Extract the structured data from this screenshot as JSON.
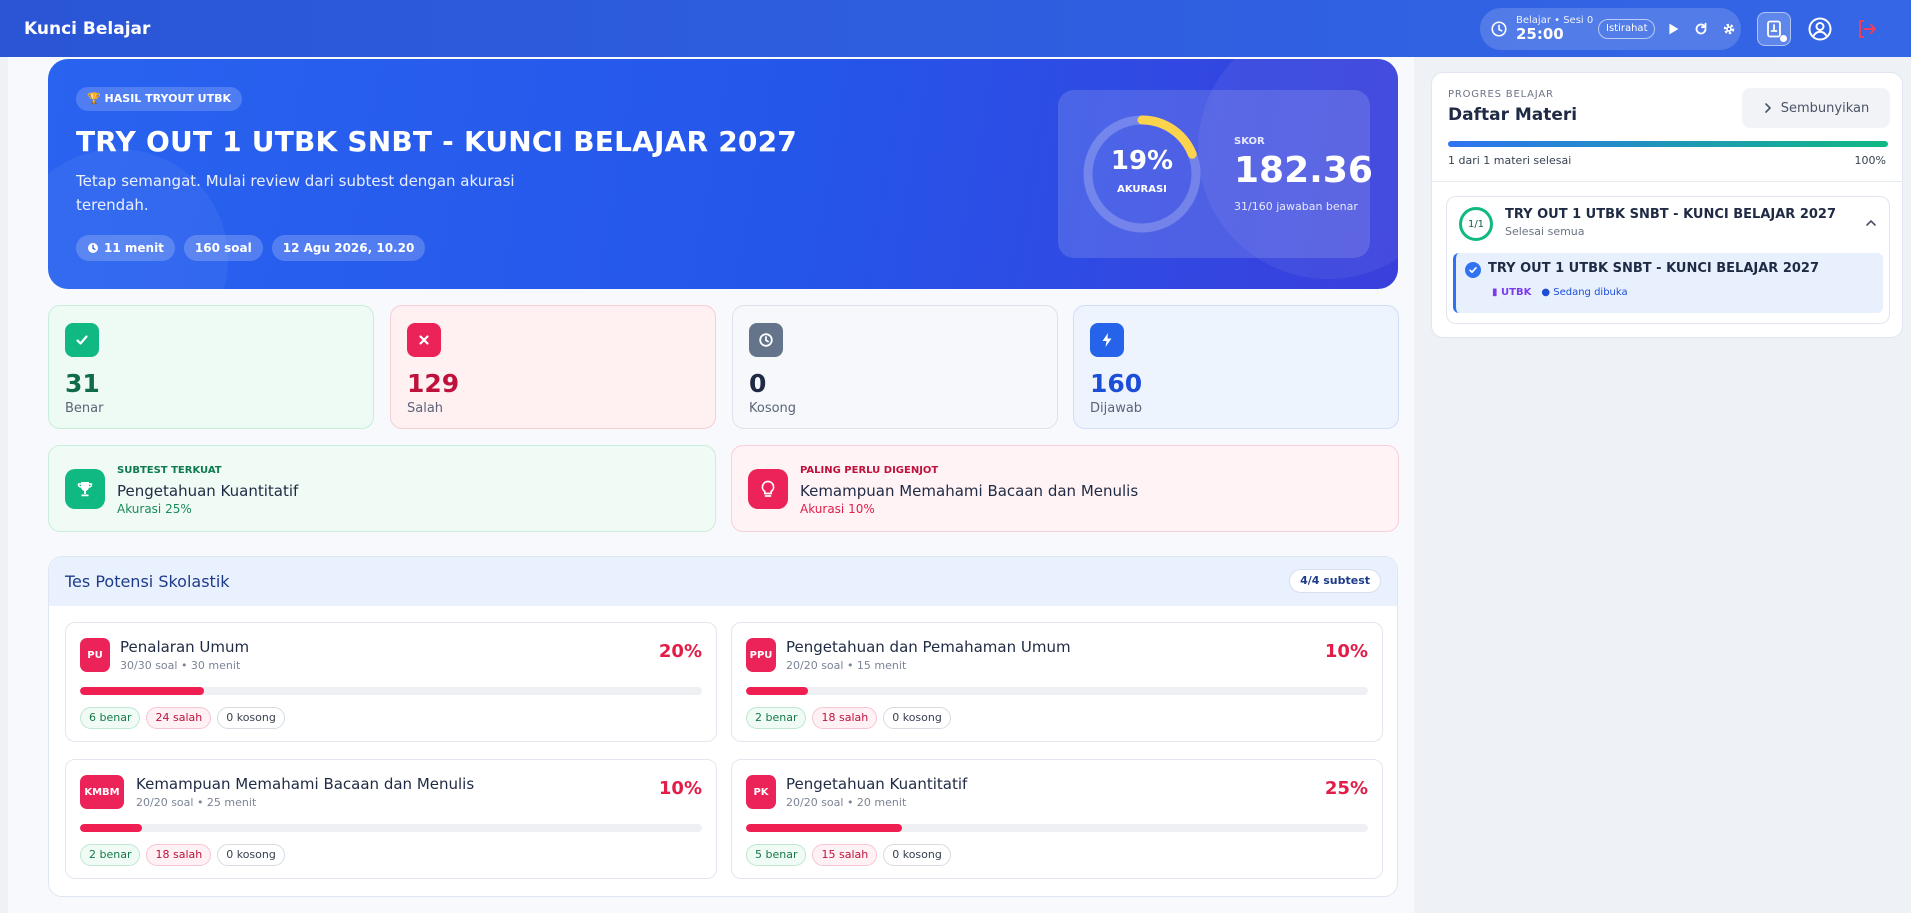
{
  "topbar": {
    "brand": "Kunci Belajar",
    "session_label": "Belajar • Sesi 0",
    "timer": "25:00",
    "break_label": "Istirahat"
  },
  "hero": {
    "badge": "HASIL TRYOUT UTBK",
    "title": "TRY OUT 1 UTBK SNBT - KUNCI BELAJAR 2027",
    "subtitle": "Tetap semangat. Mulai review dari subtest dengan akurasi terendah.",
    "chips": {
      "duration": "11 menit",
      "questions": "160 soal",
      "date": "12 Agu 2026, 10.20"
    },
    "accuracy_value": 19,
    "accuracy_text": "19%",
    "accuracy_label": "AKURASI",
    "score_label": "SKOR",
    "score": "182.36",
    "score_sub": "31/160 jawaban benar"
  },
  "stats": {
    "correct": {
      "value": "31",
      "label": "Benar"
    },
    "wrong": {
      "value": "129",
      "label": "Salah"
    },
    "empty": {
      "value": "0",
      "label": "Kosong"
    },
    "answered": {
      "value": "160",
      "label": "Dijawab"
    }
  },
  "insights": {
    "strongest": {
      "kicker": "SUBTEST TERKUAT",
      "name": "Pengetahuan Kuantitatif",
      "detail": "Akurasi 25%"
    },
    "weakest": {
      "kicker": "PALING PERLU DIGENJOT",
      "name": "Kemampuan Memahami Bacaan dan Menulis",
      "detail": "Akurasi 10%"
    }
  },
  "section": {
    "title": "Tes Potensi Skolastik",
    "count": "4/4 subtest",
    "subtests": [
      {
        "code": "PU",
        "name": "Penalaran Umum",
        "meta": "30/30 soal • 30 menit",
        "pct_text": "20%",
        "pct": 20,
        "correct": "6 benar",
        "wrong": "24 salah",
        "empty": "0 kosong"
      },
      {
        "code": "PPU",
        "name": "Pengetahuan dan Pemahaman Umum",
        "meta": "20/20 soal • 15 menit",
        "pct_text": "10%",
        "pct": 10,
        "correct": "2 benar",
        "wrong": "18 salah",
        "empty": "0 kosong"
      },
      {
        "code": "KMBM",
        "name": "Kemampuan Memahami Bacaan dan Menulis",
        "meta": "20/20 soal • 25 menit",
        "pct_text": "10%",
        "pct": 10,
        "correct": "2 benar",
        "wrong": "18 salah",
        "empty": "0 kosong"
      },
      {
        "code": "PK",
        "name": "Pengetahuan Kuantitatif",
        "meta": "20/20 soal • 20 menit",
        "pct_text": "25%",
        "pct": 25,
        "correct": "5 benar",
        "wrong": "15 salah",
        "empty": "0 kosong"
      }
    ]
  },
  "side": {
    "kicker": "PROGRES BELAJAR",
    "title": "Daftar Materi",
    "hide_label": "Sembunyikan",
    "progress_text": "1 dari 1 materi selesai",
    "progress_pct": "100%",
    "progress_value": 100,
    "course": {
      "count": "1/1",
      "name": "TRY OUT 1 UTBK SNBT - KUNCI BELAJAR 2027",
      "status": "Selesai semua",
      "lesson_name": "TRY OUT 1 UTBK SNBT - KUNCI BELAJAR 2027",
      "lesson_tag": "UTBK",
      "lesson_state": "Sedang dibuka"
    }
  },
  "colors": {
    "primary": "#2456ea",
    "success": "#10b981",
    "danger": "#e11d48",
    "neutral": "#64748b",
    "info": "#2563eb"
  }
}
